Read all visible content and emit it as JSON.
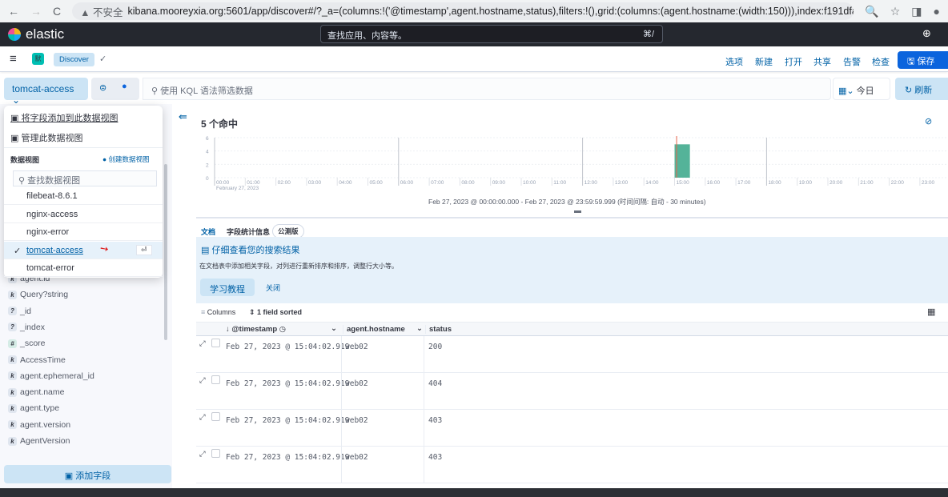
{
  "browser": {
    "insecure": "▲ 不安全",
    "url": "kibana.mooreyxia.org:5601/app/discover#/?_a=(columns:!('@timestamp',agent.hostname,status),filters:!(),grid:(columns:(agent.hostname:(width:150))),index:f191dfac-..."
  },
  "header": {
    "logo": "elastic",
    "search_placeholder": "查找应用、内容等。",
    "shortcut": "⌘/"
  },
  "breadcrumb": {
    "space": "默",
    "app": "Discover"
  },
  "topnav": [
    "选项",
    "新建",
    "打开",
    "共享",
    "告警",
    "检查"
  ],
  "save_label": "保存",
  "query": {
    "dataview": "tomcat-access",
    "placeholder": "使用 KQL 语法筛选数据",
    "date": "今日",
    "refresh": "刷新"
  },
  "popover": {
    "add_field": "将字段添加到此数据视图",
    "manage": "管理此数据视图",
    "section": "数据视图",
    "create": "创建数据视图",
    "search_placeholder": "查找数据视图",
    "items": [
      "filebeat-8.6.1",
      "nginx-access",
      "nginx-error",
      "tomcat-access",
      "tomcat-error"
    ],
    "selected": "tomcat-access"
  },
  "sidebar": {
    "fields": [
      {
        "type": "k",
        "name": "agent.id"
      },
      {
        "type": "k",
        "name": "Query?string"
      },
      {
        "type": "?",
        "name": "_id"
      },
      {
        "type": "?",
        "name": "_index"
      },
      {
        "type": "#",
        "name": "_score"
      },
      {
        "type": "k",
        "name": "AccessTime"
      },
      {
        "type": "k",
        "name": "agent.ephemeral_id"
      },
      {
        "type": "k",
        "name": "agent.name"
      },
      {
        "type": "k",
        "name": "agent.type"
      },
      {
        "type": "k",
        "name": "agent.version"
      },
      {
        "type": "k",
        "name": "AgentVersion"
      }
    ],
    "add_field": "添加字段"
  },
  "hits": "5 个命中",
  "chart_data": {
    "type": "bar",
    "x_ticks": [
      "00:00",
      "01:00",
      "02:00",
      "03:00",
      "04:00",
      "05:00",
      "06:00",
      "07:00",
      "08:00",
      "09:00",
      "10:00",
      "11:00",
      "12:00",
      "13:00",
      "14:00",
      "15:00",
      "16:00",
      "17:00",
      "18:00",
      "19:00",
      "20:00",
      "21:00",
      "22:00",
      "23:00"
    ],
    "date_label": "February 27, 2023",
    "y_ticks": [
      0,
      2,
      4,
      6
    ],
    "ylim": [
      0,
      6
    ],
    "interval": "30 minutes",
    "bars": [
      {
        "x": "15:00",
        "value": 5
      }
    ],
    "bar_color": "#54b399",
    "now_marker": "15:04"
  },
  "range_text": "Feb 27, 2023 @ 00:00:00.000 - Feb 27, 2023 @ 23:59:59.999  (时间间隔: 自动 - 30 minutes)",
  "tabs": [
    "文档",
    "字段统计信息"
  ],
  "beta": "公测版",
  "callout": {
    "title": "仔细查看您的搜索结果",
    "text": "在文档表中添加相关字段，对列进行重新排序和排序，调整行大小等。",
    "primary": "学习教程",
    "close": "关闭"
  },
  "table": {
    "columns_label": "Columns",
    "sorted_label": "1 field sorted",
    "headers": [
      "@timestamp",
      "agent.hostname",
      "status"
    ],
    "rows": [
      [
        "Feb 27, 2023 @ 15:04:02.919",
        "web02",
        "200"
      ],
      [
        "Feb 27, 2023 @ 15:04:02.919",
        "web02",
        "404"
      ],
      [
        "Feb 27, 2023 @ 15:04:02.919",
        "web02",
        "403"
      ],
      [
        "Feb 27, 2023 @ 15:04:02.919",
        "web02",
        "403"
      ]
    ]
  }
}
